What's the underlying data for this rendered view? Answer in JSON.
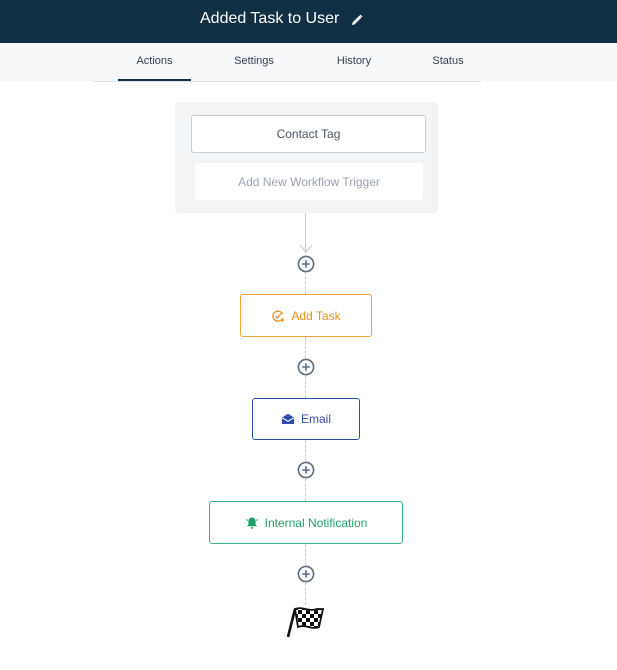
{
  "header": {
    "title": "Added Task to User",
    "edit_icon": "pencil-icon"
  },
  "tabs": [
    {
      "label": "Actions",
      "active": true
    },
    {
      "label": "Settings",
      "active": false
    },
    {
      "label": "History",
      "active": false
    },
    {
      "label": "Status",
      "active": false
    }
  ],
  "triggers": {
    "items": [
      "Contact Tag"
    ],
    "add_label": "Add New Workflow Trigger"
  },
  "actions": [
    {
      "label": "Add Task",
      "icon": "task-check-icon",
      "color": "#ea9320"
    },
    {
      "label": "Email",
      "icon": "envelope-icon",
      "color": "#2c4cae"
    },
    {
      "label": "Internal Notification",
      "icon": "bell-icon",
      "color": "#22a06b"
    }
  ],
  "add_step_icon": "plus-circle-icon",
  "end_icon": "checkered-flag-icon",
  "colors": {
    "header_bg": "#123044",
    "connector": "#c7cdd6"
  }
}
